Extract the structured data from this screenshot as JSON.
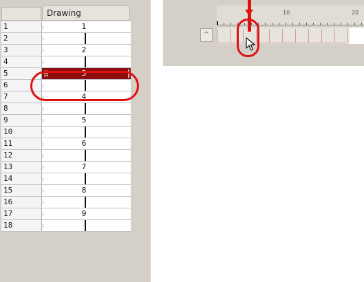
{
  "xsheet": {
    "column_header": "Drawing",
    "rows": [
      {
        "frame": "1",
        "drawing": "1",
        "selected": false,
        "hold": false
      },
      {
        "frame": "2",
        "drawing": "",
        "selected": false,
        "hold": true
      },
      {
        "frame": "3",
        "drawing": "2",
        "selected": false,
        "hold": false
      },
      {
        "frame": "4",
        "drawing": "",
        "selected": false,
        "hold": true
      },
      {
        "frame": "5",
        "drawing": "3",
        "selected": true,
        "hold": false
      },
      {
        "frame": "6",
        "drawing": "",
        "selected": false,
        "hold": true
      },
      {
        "frame": "7",
        "drawing": "4",
        "selected": false,
        "hold": false
      },
      {
        "frame": "8",
        "drawing": "",
        "selected": false,
        "hold": true
      },
      {
        "frame": "9",
        "drawing": "5",
        "selected": false,
        "hold": false
      },
      {
        "frame": "10",
        "drawing": "",
        "selected": false,
        "hold": true
      },
      {
        "frame": "11",
        "drawing": "6",
        "selected": false,
        "hold": false
      },
      {
        "frame": "12",
        "drawing": "",
        "selected": false,
        "hold": true
      },
      {
        "frame": "13",
        "drawing": "7",
        "selected": false,
        "hold": false
      },
      {
        "frame": "14",
        "drawing": "",
        "selected": false,
        "hold": true
      },
      {
        "frame": "15",
        "drawing": "8",
        "selected": false,
        "hold": false
      },
      {
        "frame": "16",
        "drawing": "",
        "selected": false,
        "hold": true
      },
      {
        "frame": "17",
        "drawing": "9",
        "selected": false,
        "hold": false
      },
      {
        "frame": "18",
        "drawing": "",
        "selected": false,
        "hold": true
      }
    ]
  },
  "timeline": {
    "ruler_labels": [
      "10",
      "20"
    ],
    "scroll_button_icon": "up-arrow-icon",
    "current_frame": "5"
  },
  "colors": {
    "selection_fill": "#8b0d0d",
    "highlight_ring": "#dd1111",
    "playhead": "#e01010"
  }
}
